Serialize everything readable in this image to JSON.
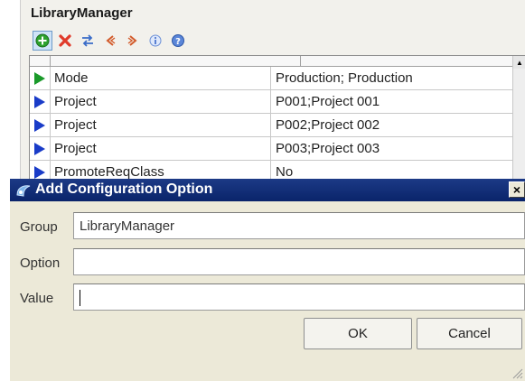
{
  "library_panel": {
    "title": "LibraryManager",
    "toolbar": [
      {
        "name": "add-icon"
      },
      {
        "name": "delete-icon"
      },
      {
        "name": "transfer-icon"
      },
      {
        "name": "move-left-icon"
      },
      {
        "name": "move-right-icon"
      },
      {
        "name": "info-icon"
      },
      {
        "name": "help-icon"
      }
    ],
    "rows": [
      {
        "key": "Mode",
        "value": "Production; Production",
        "marker_color": "#1a9a2a"
      },
      {
        "key": "Project",
        "value": "P001;Project 001",
        "marker_color": "#1a3cc8"
      },
      {
        "key": "Project",
        "value": "P002;Project 002",
        "marker_color": "#1a3cc8"
      },
      {
        "key": "Project",
        "value": "P003;Project 003",
        "marker_color": "#1a3cc8"
      },
      {
        "key": "PromoteReqClass",
        "value": "No",
        "marker_color": "#1a3cc8"
      }
    ]
  },
  "dialog": {
    "title": "Add Configuration Option",
    "fields": {
      "group": {
        "label": "Group",
        "value": "LibraryManager"
      },
      "option": {
        "label": "Option",
        "value": ""
      },
      "value": {
        "label": "Value",
        "value": ""
      }
    },
    "ok_label": "OK",
    "cancel_label": "Cancel"
  },
  "colors": {
    "titlebar": "#0a246a",
    "dialog_bg": "#ece9d8",
    "panel_bg": "#f2f1ec"
  }
}
